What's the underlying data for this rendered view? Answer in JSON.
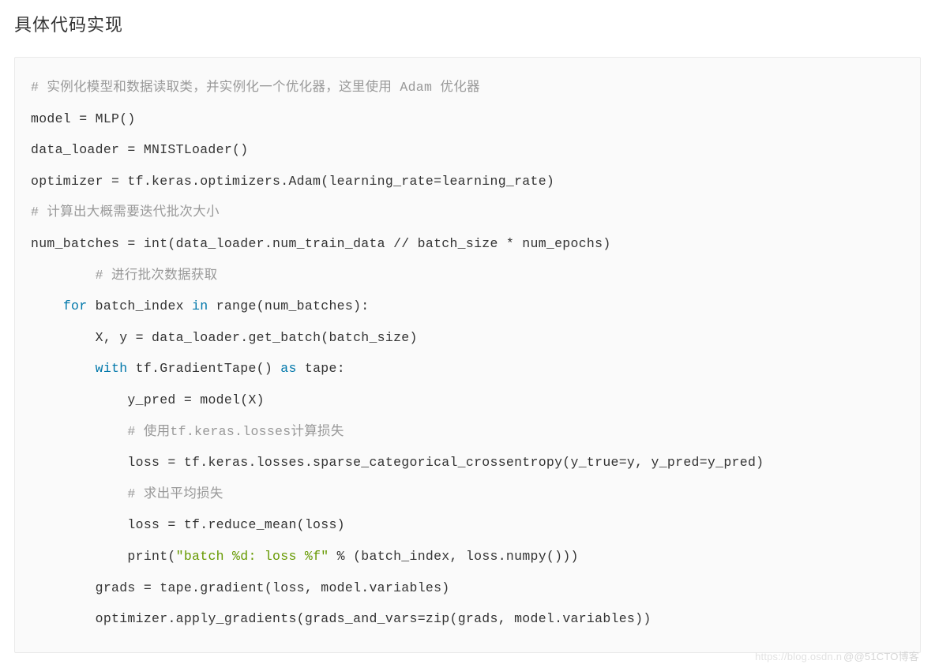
{
  "heading": "具体代码实现",
  "code": {
    "lines": [
      {
        "indent": 0,
        "segs": [
          {
            "t": "# 实例化模型和数据读取类，并实例化一个优化器，这里使用 Adam 优化器",
            "c": "c"
          }
        ]
      },
      {
        "indent": 0,
        "segs": [
          {
            "t": "model = MLP()",
            "c": "p"
          }
        ]
      },
      {
        "indent": 0,
        "segs": [
          {
            "t": "data_loader = MNISTLoader()",
            "c": "p"
          }
        ]
      },
      {
        "indent": 0,
        "segs": [
          {
            "t": "optimizer = tf.keras.optimizers.Adam(learning_rate=learning_rate)",
            "c": "p"
          }
        ]
      },
      {
        "indent": 0,
        "segs": [
          {
            "t": "# 计算出大概需要迭代批次大小",
            "c": "c"
          }
        ]
      },
      {
        "indent": 0,
        "segs": [
          {
            "t": "num_batches = int(data_loader.num_train_data // batch_size * num_epochs)",
            "c": "p"
          }
        ]
      },
      {
        "indent": 2,
        "segs": [
          {
            "t": "# 进行批次数据获取",
            "c": "c"
          }
        ]
      },
      {
        "indent": 1,
        "segs": [
          {
            "t": "for",
            "c": "k"
          },
          {
            "t": " batch_index ",
            "c": "p"
          },
          {
            "t": "in",
            "c": "k"
          },
          {
            "t": " range(num_batches):",
            "c": "p"
          }
        ]
      },
      {
        "indent": 2,
        "segs": [
          {
            "t": "X, y = data_loader.get_batch(batch_size)",
            "c": "p"
          }
        ]
      },
      {
        "indent": 2,
        "segs": [
          {
            "t": "with",
            "c": "k"
          },
          {
            "t": " tf.GradientTape() ",
            "c": "p"
          },
          {
            "t": "as",
            "c": "k"
          },
          {
            "t": " tape:",
            "c": "p"
          }
        ]
      },
      {
        "indent": 3,
        "segs": [
          {
            "t": "y_pred = model(X)",
            "c": "p"
          }
        ]
      },
      {
        "indent": 3,
        "segs": [
          {
            "t": "# 使用tf.keras.losses计算损失",
            "c": "c"
          }
        ]
      },
      {
        "indent": 3,
        "segs": [
          {
            "t": "loss = tf.keras.losses.sparse_categorical_crossentropy(y_true=y, y_pred=y_pred)",
            "c": "p"
          }
        ]
      },
      {
        "indent": 3,
        "segs": [
          {
            "t": "# 求出平均损失",
            "c": "c"
          }
        ]
      },
      {
        "indent": 3,
        "segs": [
          {
            "t": "loss = tf.reduce_mean(loss)",
            "c": "p"
          }
        ]
      },
      {
        "indent": 3,
        "segs": [
          {
            "t": "print(",
            "c": "p"
          },
          {
            "t": "\"batch %d: loss %f\"",
            "c": "s"
          },
          {
            "t": " % (batch_index, loss.numpy()))",
            "c": "p"
          }
        ]
      },
      {
        "indent": 2,
        "segs": [
          {
            "t": "grads = tape.gradient(loss, model.variables)",
            "c": "p"
          }
        ]
      },
      {
        "indent": 2,
        "segs": [
          {
            "t": "optimizer.apply_gradients(grads_and_vars=zip(grads, model.variables))",
            "c": "p"
          }
        ]
      }
    ]
  },
  "watermark": {
    "left": "https://blog.osdn.n",
    "right": "@@51CTO博客"
  }
}
